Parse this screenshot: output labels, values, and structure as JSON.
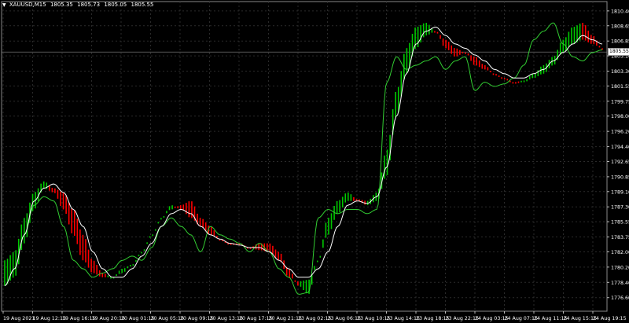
{
  "header": {
    "symbol": "XAUUSD,M15",
    "open": "1805.35",
    "high": "1805.73",
    "low": "1805.05",
    "close": "1805.55"
  },
  "current_price": "1805.55",
  "colors": {
    "background": "#000000",
    "grid": "#2a2a2a",
    "axis_text": "#ffffff",
    "bull": "#00c800",
    "bear": "#ff0000",
    "price_line": "#32cd32",
    "ma_line": "#ffffff"
  },
  "chart_data": {
    "type": "line",
    "title": "XAUUSD,M15",
    "ylim": [
      1775.0,
      1811.5
    ],
    "y_ticks": [
      "1810.40",
      "1808.65",
      "1806.85",
      "1805.10",
      "1803.30",
      "1801.55",
      "1799.75",
      "1798.00",
      "1796.20",
      "1794.40",
      "1792.65",
      "1790.85",
      "1789.10",
      "1787.30",
      "1785.55",
      "1783.75",
      "1782.00",
      "1780.20",
      "1778.40",
      "1776.60"
    ],
    "x_ticks": [
      "19 Aug 2021",
      "19 Aug 12:15",
      "19 Aug 16:15",
      "19 Aug 20:15",
      "20 Aug 01:15",
      "20 Aug 05:15",
      "20 Aug 09:15",
      "20 Aug 13:15",
      "20 Aug 17:15",
      "20 Aug 21:15",
      "23 Aug 02:15",
      "23 Aug 06:15",
      "23 Aug 10:15",
      "23 Aug 14:15",
      "23 Aug 18:15",
      "23 Aug 22:15",
      "24 Aug 03:15",
      "24 Aug 07:15",
      "24 Aug 11:15",
      "24 Aug 15:15",
      "24 Aug 19:15"
    ],
    "grid": true,
    "series": [
      {
        "values": [
          1781,
          1782,
          1786,
          1789,
          1790.3,
          1789.5,
          1789,
          1787,
          1784,
          1781,
          1779.5,
          1779,
          1780,
          1780.5,
          1782,
          1784,
          1786,
          1787,
          1787.5,
          1788,
          1786,
          1785,
          1783.5,
          1783,
          1783,
          1782.5,
          1783,
          1783,
          1782,
          1780,
          1778,
          1777,
          1781,
          1786,
          1788,
          1789,
          1788.2,
          1788,
          1789,
          1794,
          1801,
          1806,
          1808.5,
          1809,
          1808,
          1806,
          1805,
          1805.5,
          1804,
          1803.5,
          1803,
          1802.5,
          1802,
          1802.2,
          1803,
          1804,
          1805,
          1807,
          1808.5,
          1809,
          1807.5,
          1806
        ]
      },
      {
        "values": [
          1778,
          1779,
          1783,
          1787,
          1789.5,
          1789,
          1787,
          1784,
          1781,
          1779.5,
          1779,
          1779,
          1779.5,
          1780.5,
          1782,
          1784,
          1786,
          1787.5,
          1787,
          1786,
          1785,
          1784,
          1783.5,
          1783,
          1783,
          1782.5,
          1782.2,
          1782,
          1781,
          1779,
          1778.5,
          1778.7,
          1781,
          1784,
          1786.5,
          1788,
          1788,
          1787.5,
          1788,
          1791,
          1798,
          1803,
          1806,
          1807.5,
          1808,
          1807,
          1806,
          1805.5,
          1805,
          1804,
          1803,
          1802.5,
          1802,
          1802,
          1802.5,
          1803,
          1804,
          1805.5,
          1806.5,
          1807,
          1806.5,
          1806
        ]
      },
      {
        "values": [
          1778,
          1780,
          1784,
          1788,
          1789.5,
          1790,
          1789,
          1787,
          1785,
          1782,
          1780,
          1779,
          1779,
          1780,
          1781.5,
          1783,
          1785,
          1786.5,
          1787,
          1786.5,
          1785,
          1784,
          1783.5,
          1783,
          1782.8,
          1782.5,
          1782.5,
          1782,
          1781,
          1780,
          1779,
          1779,
          1780,
          1782,
          1785,
          1787.5,
          1788,
          1787.7,
          1788.5,
          1792,
          1798,
          1803,
          1806.5,
          1808,
          1808.5,
          1807.5,
          1806.5,
          1806,
          1805.2,
          1804.5,
          1803.5,
          1803,
          1802.5,
          1802.5,
          1803,
          1803.5,
          1804.5,
          1805.5,
          1806.5,
          1807.5,
          1807,
          1806.5
        ]
      },
      {
        "values": [
          1778,
          1780,
          1784,
          1787.5,
          1788.5,
          1788,
          1785,
          1781,
          1780,
          1779,
          1779.5,
          1780,
          1781,
          1781.5,
          1781,
          1782.5,
          1785,
          1786,
          1785,
          1784,
          1782,
          1785,
          1784,
          1783.5,
          1783,
          1782,
          1783,
          1782,
          1780,
          1779,
          1777,
          1777.2,
          1786,
          1787,
          1786.5,
          1787,
          1787,
          1786.5,
          1787,
          1802,
          1805,
          1803.5,
          1804,
          1804.5,
          1805,
          1803.5,
          1804.5,
          1805,
          1801,
          1802,
          1801.5,
          1801.8,
          1802.5,
          1804,
          1807,
          1808,
          1809,
          1806.5,
          1805,
          1804.5,
          1805.5,
          1805.8
        ]
      }
    ]
  }
}
